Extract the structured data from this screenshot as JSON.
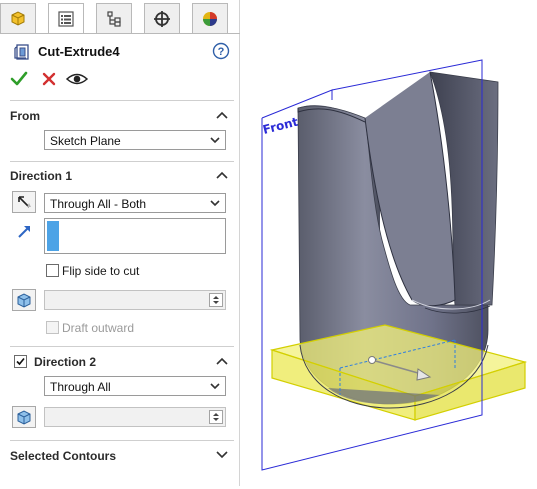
{
  "feature_title": "Cut-Extrude4",
  "tabs": [
    {
      "icon": "featuremanager-icon"
    },
    {
      "icon": "propertymanager-icon",
      "active": true
    },
    {
      "icon": "configurationmanager-icon"
    },
    {
      "icon": "dimxpert-icon"
    },
    {
      "icon": "display-manager-icon"
    }
  ],
  "actions": {
    "ok": "confirm-check-icon",
    "cancel": "cancel-x-icon",
    "preview": "preview-eye-icon"
  },
  "from": {
    "header": "From",
    "value": "Sketch Plane"
  },
  "direction1": {
    "header": "Direction 1",
    "end_condition": "Through All - Both",
    "flip_side_label": "Flip side to cut",
    "flip_side_checked": false,
    "draft_outward_label": "Draft outward",
    "draft_outward_checked": false,
    "draft_value": ""
  },
  "direction2": {
    "header": "Direction 2",
    "checked": true,
    "end_condition": "Through All",
    "draft_value": ""
  },
  "selected_contours": {
    "header": "Selected Contours"
  },
  "viewport": {
    "plane_label": "Front Plane",
    "colors": {
      "plane": "#2a2ad6",
      "body": "#6f7282",
      "preview": "#f2f07a",
      "preview_edge": "#d3cf00"
    }
  }
}
